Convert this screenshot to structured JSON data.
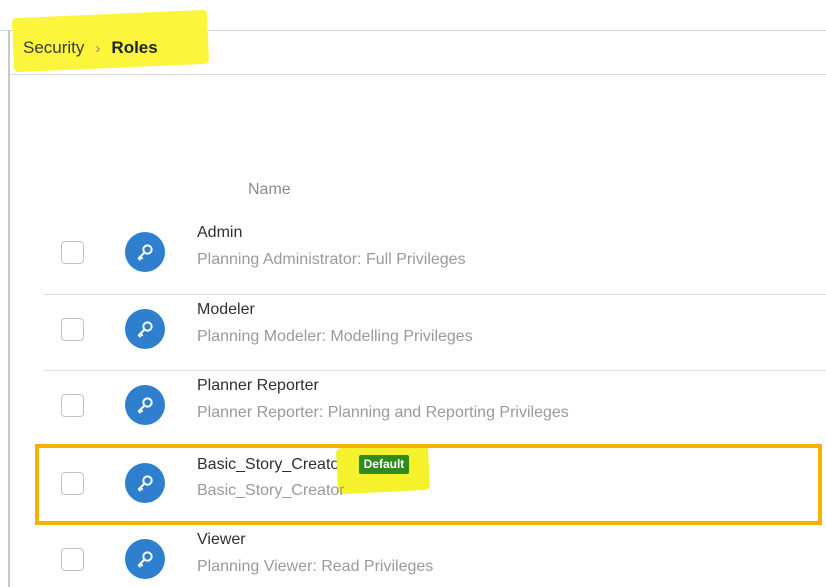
{
  "breadcrumb": {
    "parent": "Security",
    "separator": "›",
    "current": "Roles"
  },
  "table": {
    "column_header": "Name"
  },
  "roles": [
    {
      "name": "Admin",
      "description": "Planning Administrator: Full Privileges",
      "badge": ""
    },
    {
      "name": "Modeler",
      "description": "Planning Modeler: Modelling Privileges",
      "badge": ""
    },
    {
      "name": "Planner Reporter",
      "description": "Planner Reporter: Planning and Reporting Privileges",
      "badge": ""
    },
    {
      "name": "Basic_Story_Creator",
      "description": "Basic_Story_Creator",
      "badge": "Default"
    },
    {
      "name": "Viewer",
      "description": "Planning Viewer: Read Privileges",
      "badge": ""
    }
  ],
  "icons": {
    "role_icon": "key-icon"
  },
  "colors": {
    "icon_bg": "#2e7fcd",
    "badge_bg": "#2e8b1d",
    "highlight_yellow": "#fbf432",
    "selection_border": "#f5b301"
  }
}
